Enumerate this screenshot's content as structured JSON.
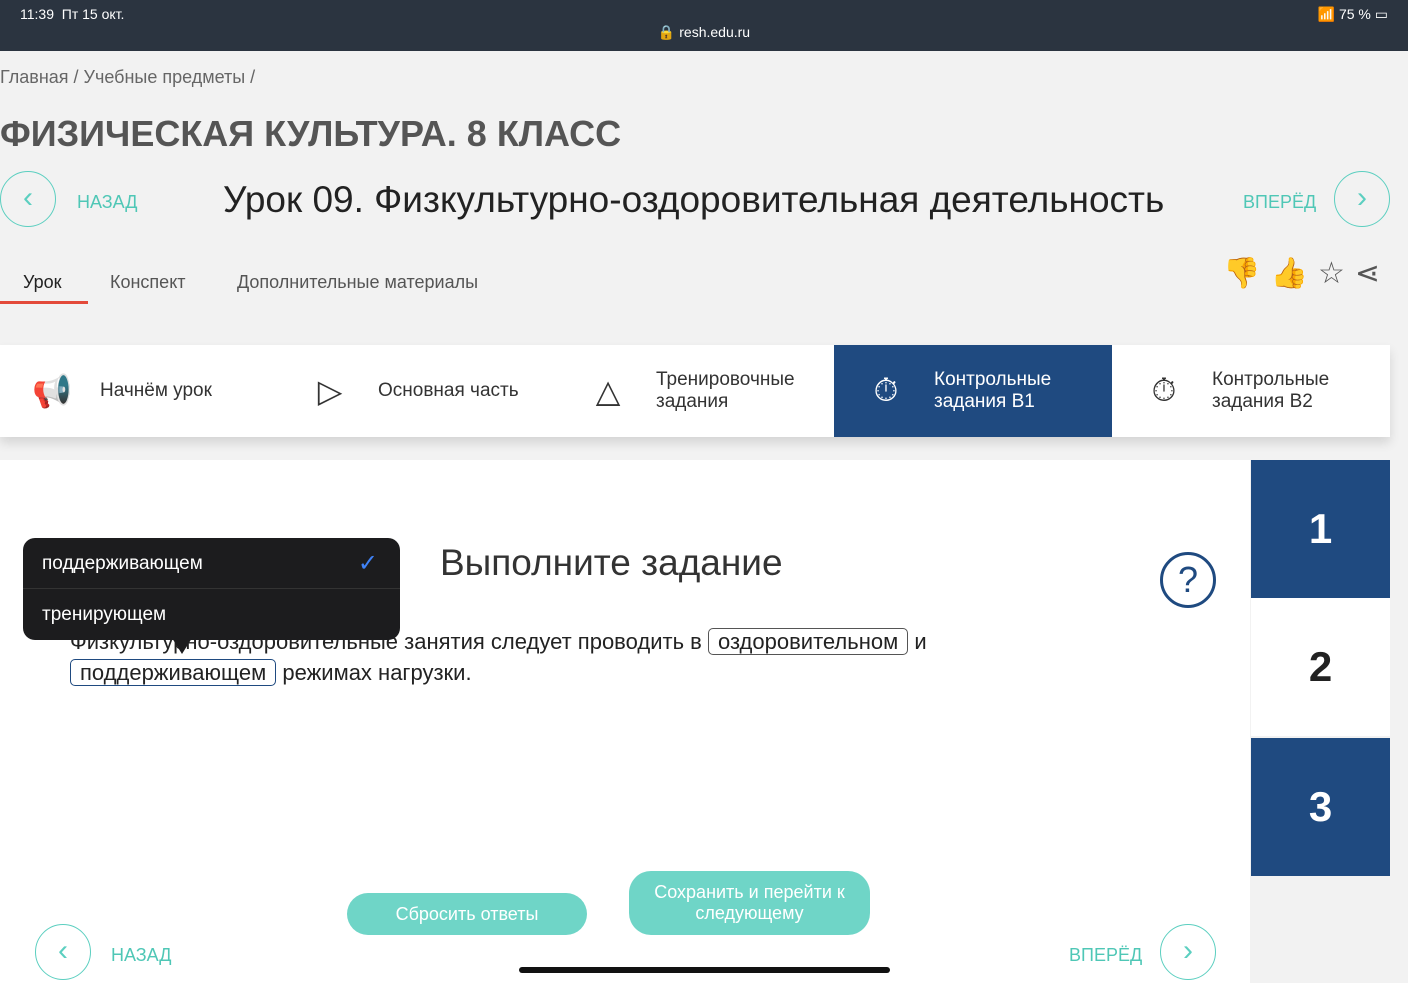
{
  "status": {
    "time": "11:39",
    "date": "Пт 15 окт.",
    "url": "resh.edu.ru",
    "battery": "75 %"
  },
  "breadcrumb": "Главная  /  Учебные предметы  /",
  "title": "ФИЗИЧЕСКАЯ КУЛЬТУРА. 8 КЛАСС",
  "lesson": {
    "title": "Урок 09. Физкультурно-оздоровительная деятельность",
    "back": "НАЗАД",
    "forward": "ВПЕРЁД"
  },
  "tabs": [
    "Урок",
    "Конспект",
    "Дополнительные материалы"
  ],
  "steps": [
    {
      "label": "Начнём урок",
      "icon": "megaphone-icon"
    },
    {
      "label": "Основная часть",
      "icon": "play-icon"
    },
    {
      "label": "Тренировочные задания",
      "icon": "pyramid-icon"
    },
    {
      "label": "Контрольные задания В1",
      "icon": "stopwatch-icon"
    },
    {
      "label": "Контрольные задания В2",
      "icon": "stopwatch-icon"
    }
  ],
  "task": {
    "heading": "Выполните задание",
    "help": "?",
    "text1": "Физкультурно-оздоровительные занятия следует проводить в",
    "answer1": "оздоровительном",
    "text2": "и",
    "answer2": "поддерживающем",
    "text3": "режимах нагрузки."
  },
  "numbers": [
    "1",
    "2",
    "3"
  ],
  "buttons": {
    "reset": "Сбросить ответы",
    "save": "Сохранить и перейти к следующему"
  },
  "dropdown": {
    "options": [
      "поддерживающем",
      "тренирующем"
    ],
    "selected": "поддерживающем"
  },
  "bottom": {
    "back": "НАЗАД",
    "forward": "ВПЕРЁД"
  },
  "colors": {
    "accent": "#5ccfc0",
    "active": "#1f4a80"
  }
}
